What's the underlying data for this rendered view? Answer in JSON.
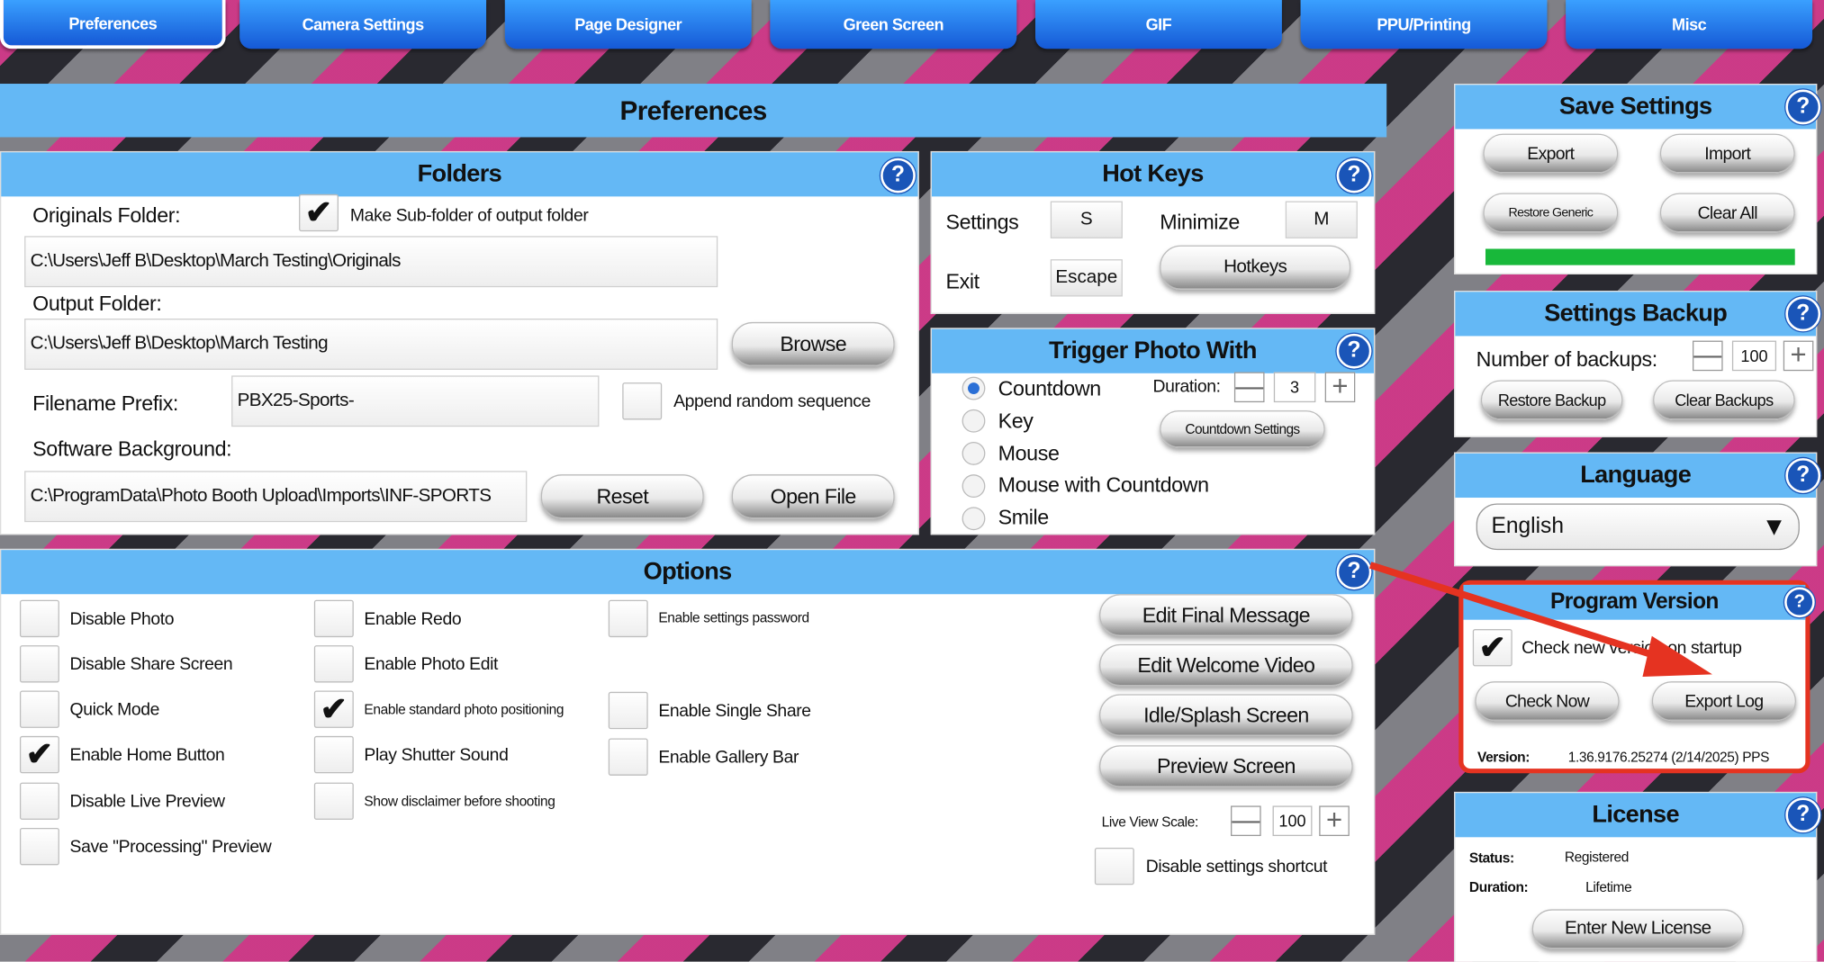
{
  "tabs": [
    "Preferences",
    "Camera Settings",
    "Page Designer",
    "Green Screen",
    "GIF",
    "PPU/Printing",
    "Misc"
  ],
  "main_title": "Preferences",
  "help_glyph": "?",
  "check_glyph": "✔",
  "folders": {
    "title": "Folders",
    "originals_label": "Originals Folder:",
    "make_subfolder_label": "Make Sub-folder of output folder",
    "make_subfolder_checked": true,
    "originals_path": "C:\\Users\\Jeff B\\Desktop\\March Testing\\Originals",
    "output_label": "Output Folder:",
    "output_path": "C:\\Users\\Jeff B\\Desktop\\March Testing",
    "browse_label": "Browse",
    "prefix_label": "Filename Prefix:",
    "prefix_value": "PBX25-Sports-",
    "append_random_label": "Append random sequence",
    "append_random_checked": false,
    "background_label": "Software Background:",
    "background_path": "C:\\ProgramData\\Photo Booth Upload\\Imports\\INF-SPORTS",
    "reset_label": "Reset",
    "open_file_label": "Open File"
  },
  "hotkeys": {
    "title": "Hot Keys",
    "settings_label": "Settings",
    "settings_key": "S",
    "minimize_label": "Minimize",
    "minimize_key": "M",
    "exit_label": "Exit",
    "exit_key": "Escape",
    "hotkeys_button": "Hotkeys"
  },
  "trigger": {
    "title": "Trigger Photo With",
    "options": [
      "Countdown",
      "Key",
      "Mouse",
      "Mouse with Countdown",
      "Smile"
    ],
    "selected": "Countdown",
    "duration_label": "Duration:",
    "duration_value": "3",
    "countdown_settings_button": "Countdown Settings",
    "minus": "—",
    "plus": "+"
  },
  "options": {
    "title": "Options",
    "col1": [
      {
        "label": "Disable Photo",
        "checked": false
      },
      {
        "label": "Disable Share Screen",
        "checked": false
      },
      {
        "label": "Quick Mode",
        "checked": false
      },
      {
        "label": "Enable Home Button",
        "checked": true
      },
      {
        "label": "Disable Live Preview",
        "checked": false
      },
      {
        "label": "Save \"Processing\" Preview",
        "checked": false
      }
    ],
    "col2": [
      {
        "label": "Enable Redo",
        "checked": false
      },
      {
        "label": "Enable Photo Edit",
        "checked": false
      },
      {
        "label": "Enable standard photo positioning",
        "checked": true
      },
      {
        "label": "Play Shutter Sound",
        "checked": false
      },
      {
        "label": "Show disclaimer before shooting",
        "checked": false
      }
    ],
    "col3": [
      {
        "label": "Enable settings password",
        "checked": false
      },
      {
        "label": "Enable Single Share",
        "checked": false
      },
      {
        "label": "Enable Gallery Bar",
        "checked": false
      }
    ],
    "buttons": [
      "Edit Final Message",
      "Edit Welcome Video",
      "Idle/Splash Screen",
      "Preview Screen"
    ],
    "live_view_label": "Live View Scale:",
    "live_view_value": "100",
    "disable_shortcut_label": "Disable settings shortcut",
    "disable_shortcut_checked": false
  },
  "save_settings": {
    "title": "Save Settings",
    "export": "Export",
    "import": "Import",
    "restore_generic": "Restore Generic",
    "clear_all": "Clear All",
    "status_color": "#18b83a"
  },
  "settings_backup": {
    "title": "Settings Backup",
    "number_label": "Number of backups:",
    "number_value": "100",
    "restore_backup": "Restore Backup",
    "clear_backups": "Clear Backups"
  },
  "language": {
    "title": "Language",
    "selected": "English",
    "arrow": "▼"
  },
  "program_version": {
    "title": "Program Version",
    "check_label": "Check new version on startup",
    "check_checked": true,
    "check_now": "Check Now",
    "export_log": "Export Log",
    "version_label": "Version:",
    "version_value": "1.36.9176.25274 (2/14/2025) PPS",
    "highlight_color": "#e53321"
  },
  "license": {
    "title": "License",
    "status_label": "Status:",
    "status_value": "Registered",
    "duration_label": "Duration:",
    "duration_value": "Lifetime",
    "enter_new": "Enter New License"
  }
}
